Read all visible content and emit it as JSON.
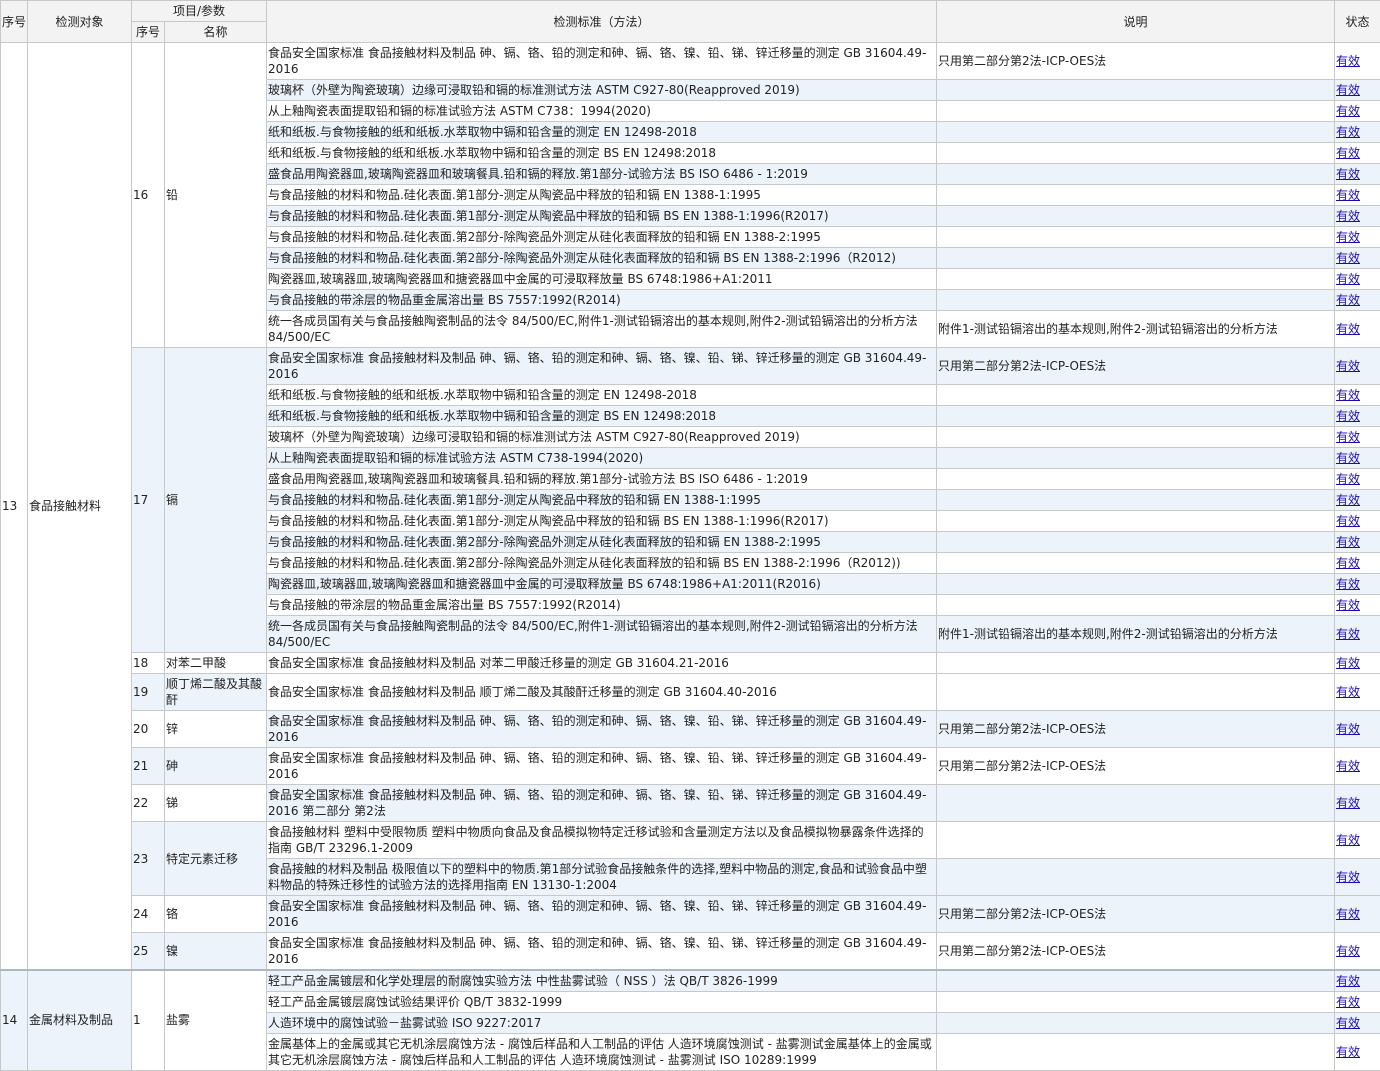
{
  "header": {
    "col_seq": "序号",
    "col_object": "检测对象",
    "col_item_group": "项目/参数",
    "col_item_no": "序号",
    "col_item_name": "名称",
    "col_standard": "检测标准（方法）",
    "col_note": "说明",
    "col_status": "状态"
  },
  "status_text": "有效",
  "groups": [
    {
      "seq": "13",
      "object": "食品接触材料",
      "items": [
        {
          "no": "16",
          "name": "铅",
          "rows": [
            {
              "std": "食品安全国家标准 食品接触材料及制品 砷、镉、铬、铅的测定和砷、镉、铬、镍、铅、锑、锌迁移量的测定 GB 31604.49-2016",
              "note": "只用第二部分第2法-ICP-OES法",
              "h": 37
            },
            {
              "std": "玻璃杯（外壁为陶瓷玻璃）边缘可浸取铅和镉的标准测试方法 ASTM C927-80(Reapproved 2019)",
              "note": "",
              "h": 21
            },
            {
              "std": "从上釉陶瓷表面提取铅和镉的标准试验方法 ASTM C738：1994(2020)",
              "note": "",
              "h": 21
            },
            {
              "std": "纸和纸板.与食物接触的纸和纸板.水萃取物中镉和铅含量的测定 EN 12498-2018",
              "note": "",
              "h": 21
            },
            {
              "std": "纸和纸板.与食物接触的纸和纸板.水萃取物中镉和铅含量的测定 BS EN 12498:2018",
              "note": "",
              "h": 21
            },
            {
              "std": "盛食品用陶瓷器皿,玻璃陶瓷器皿和玻璃餐具.铅和镉的释放.第1部分-试验方法 BS ISO 6486 - 1:2019",
              "note": "",
              "h": 21
            },
            {
              "std": "与食品接触的材料和物品.硅化表面.第1部分-测定从陶瓷品中释放的铅和镉 EN 1388-1:1995",
              "note": "",
              "h": 21
            },
            {
              "std": "与食品接触的材料和物品.硅化表面.第1部分-测定从陶瓷品中释放的铅和镉 BS EN 1388-1:1996(R2017)",
              "note": "",
              "h": 21
            },
            {
              "std": "与食品接触的材料和物品.硅化表面.第2部分-除陶瓷品外测定从硅化表面释放的铅和镉 EN 1388-2:1995",
              "note": "",
              "h": 21
            },
            {
              "std": "与食品接触的材料和物品.硅化表面.第2部分-除陶瓷品外测定从硅化表面释放的铅和镉 BS EN 1388-2:1996（R2012)",
              "note": "",
              "h": 21
            },
            {
              "std": "陶瓷器皿,玻璃器皿,玻璃陶瓷器皿和搪瓷器皿中金属的可浸取释放量 BS 6748:1986+A1:2011",
              "note": "",
              "h": 21
            },
            {
              "std": "与食品接触的带涂层的物品重金属溶出量 BS 7557:1992(R2014)",
              "note": "",
              "h": 21
            },
            {
              "std": "统一各成员国有关与食品接触陶瓷制品的法令 84/500/EC,附件1-测试铅镉溶出的基本规则,附件2-测试铅镉溶出的分析方法 84/500/EC",
              "note": "附件1-测试铅镉溶出的基本规则,附件2-测试铅镉溶出的分析方法",
              "h": 37
            }
          ]
        },
        {
          "no": "17",
          "name": "镉",
          "rows": [
            {
              "std": "食品安全国家标准 食品接触材料及制品 砷、镉、铬、铅的测定和砷、镉、铬、镍、铅、锑、锌迁移量的测定 GB 31604.49-2016",
              "note": "只用第二部分第2法-ICP-OES法",
              "h": 37
            },
            {
              "std": "纸和纸板.与食物接触的纸和纸板.水萃取物中镉和铅含量的测定 EN 12498-2018",
              "note": "",
              "h": 21
            },
            {
              "std": "纸和纸板.与食物接触的纸和纸板.水萃取物中镉和铅含量的测定 BS EN 12498:2018",
              "note": "",
              "h": 21
            },
            {
              "std": "玻璃杯（外壁为陶瓷玻璃）边缘可浸取铅和镉的标准测试方法 ASTM C927-80(Reapproved 2019)",
              "note": "",
              "h": 21
            },
            {
              "std": "从上釉陶瓷表面提取铅和镉的标准试验方法 ASTM C738-1994(2020)",
              "note": "",
              "h": 21
            },
            {
              "std": "盛食品用陶瓷器皿,玻璃陶瓷器皿和玻璃餐具.铅和镉的释放.第1部分-试验方法 BS ISO 6486 - 1:2019",
              "note": "",
              "h": 21
            },
            {
              "std": "与食品接触的材料和物品.硅化表面.第1部分-测定从陶瓷品中释放的铅和镉 EN 1388-1:1995",
              "note": "",
              "h": 21
            },
            {
              "std": "与食品接触的材料和物品.硅化表面.第1部分-测定从陶瓷品中释放的铅和镉 BS EN 1388-1:1996(R2017)",
              "note": "",
              "h": 21
            },
            {
              "std": "与食品接触的材料和物品.硅化表面.第2部分-除陶瓷品外测定从硅化表面释放的铅和镉 EN 1388-2:1995",
              "note": "",
              "h": 21
            },
            {
              "std": "与食品接触的材料和物品.硅化表面.第2部分-除陶瓷品外测定从硅化表面释放的铅和镉 BS EN 1388-2:1996（R2012))",
              "note": "",
              "h": 21
            },
            {
              "std": "陶瓷器皿,玻璃器皿,玻璃陶瓷器皿和搪瓷器皿中金属的可浸取释放量 BS 6748:1986+A1:2011(R2016)",
              "note": "",
              "h": 21
            },
            {
              "std": "与食品接触的带涂层的物品重金属溶出量 BS 7557:1992(R2014)",
              "note": "",
              "h": 21
            },
            {
              "std": "统一各成员国有关与食品接触陶瓷制品的法令 84/500/EC,附件1-测试铅镉溶出的基本规则,附件2-测试铅镉溶出的分析方法 84/500/EC",
              "note": "附件1-测试铅镉溶出的基本规则,附件2-测试铅镉溶出的分析方法",
              "h": 37
            }
          ]
        },
        {
          "no": "18",
          "name": "对苯二甲酸",
          "rows": [
            {
              "std": "食品安全国家标准 食品接触材料及制品 对苯二甲酸迁移量的测定 GB 31604.21-2016",
              "note": "",
              "h": 21
            }
          ]
        },
        {
          "no": "19",
          "name": "顺丁烯二酸及其酸酐",
          "rows": [
            {
              "std": "食品安全国家标准 食品接触材料及制品 顺丁烯二酸及其酸酐迁移量的测定 GB 31604.40-2016",
              "note": "",
              "h": 37
            }
          ]
        },
        {
          "no": "20",
          "name": "锌",
          "rows": [
            {
              "std": "食品安全国家标准 食品接触材料及制品 砷、镉、铬、铅的测定和砷、镉、铬、镍、铅、锑、锌迁移量的测定 GB 31604.49-2016",
              "note": "只用第二部分第2法-ICP-OES法",
              "h": 37
            }
          ]
        },
        {
          "no": "21",
          "name": "砷",
          "rows": [
            {
              "std": "食品安全国家标准 食品接触材料及制品 砷、镉、铬、铅的测定和砷、镉、铬、镍、铅、锑、锌迁移量的测定 GB 31604.49-2016",
              "note": "只用第二部分第2法-ICP-OES法",
              "h": 37
            }
          ]
        },
        {
          "no": "22",
          "name": "锑",
          "rows": [
            {
              "std": "食品安全国家标准 食品接触材料及制品 砷、镉、铬、铅的测定和砷、镉、铬、镍、铅、锑、锌迁移量的测定 GB 31604.49-2016 第二部分 第2法",
              "note": "",
              "h": 37
            }
          ]
        },
        {
          "no": "23",
          "name": "特定元素迁移",
          "rows": [
            {
              "std": "食品接触材料 塑料中受限物质 塑料中物质向食品及食品模拟物特定迁移试验和含量测定方法以及食品模拟物暴露条件选择的指南 GB/T 23296.1-2009",
              "note": "",
              "h": 37
            },
            {
              "std": "食品接触的材料及制品 极限值以下的塑料中的物质.第1部分试验食品接触条件的选择,塑料中物品的测定,食品和试验食品中塑料物品的特殊迁移性的试验方法的选择用指南 EN 13130-1:2004",
              "note": "",
              "h": 37
            }
          ]
        },
        {
          "no": "24",
          "name": "铬",
          "rows": [
            {
              "std": "食品安全国家标准 食品接触材料及制品 砷、镉、铬、铅的测定和砷、镉、铬、镍、铅、锑、锌迁移量的测定 GB 31604.49-2016",
              "note": "只用第二部分第2法-ICP-OES法",
              "h": 37
            }
          ]
        },
        {
          "no": "25",
          "name": "镍",
          "rows": [
            {
              "std": "食品安全国家标准 食品接触材料及制品 砷、镉、铬、铅的测定和砷、镉、铬、镍、铅、锑、锌迁移量的测定 GB 31604.49-2016",
              "note": "只用第二部分第2法-ICP-OES法",
              "h": 37
            }
          ]
        }
      ]
    },
    {
      "seq": "14",
      "object": "金属材料及制品",
      "items": [
        {
          "no": "1",
          "name": "盐雾",
          "rows": [
            {
              "std": "轻工产品金属镀层和化学处理层的耐腐蚀实验方法 中性盐雾试验（ NSS ）法 QB/T 3826-1999",
              "note": "",
              "h": 21
            },
            {
              "std": "轻工产品金属镀层腐蚀试验结果评价 QB/T 3832-1999",
              "note": "",
              "h": 21
            },
            {
              "std": "人造环境中的腐蚀试验－盐雾试验 ISO 9227:2017",
              "note": "",
              "h": 21
            },
            {
              "std": "金属基体上的金属或其它无机涂层腐蚀方法 - 腐蚀后样品和人工制品的评估 人造环境腐蚀测试 - 盐雾测试金属基体上的金属或其它无机涂层腐蚀方法 - 腐蚀后样品和人工制品的评估 人造环境腐蚀测试 - 盐雾测试 ISO 10289:1999",
              "note": "",
              "h": 37
            }
          ]
        }
      ]
    }
  ],
  "row_bg": [
    "w",
    "b",
    "w",
    "b",
    "w",
    "b",
    "w",
    "b",
    "w",
    "b",
    "w",
    "b",
    "w",
    "b",
    "w",
    "b",
    "w",
    "b",
    "w",
    "b",
    "w",
    "b",
    "w",
    "b",
    "w",
    "b",
    "w",
    "w",
    "b",
    "w",
    "b",
    "w",
    "b",
    "b",
    "w",
    "b",
    "w",
    "b",
    "w",
    "b"
  ],
  "item_bg": [
    "w",
    "b",
    "w",
    "b",
    "w",
    "b",
    "w",
    "b",
    "w",
    "b",
    "w"
  ]
}
